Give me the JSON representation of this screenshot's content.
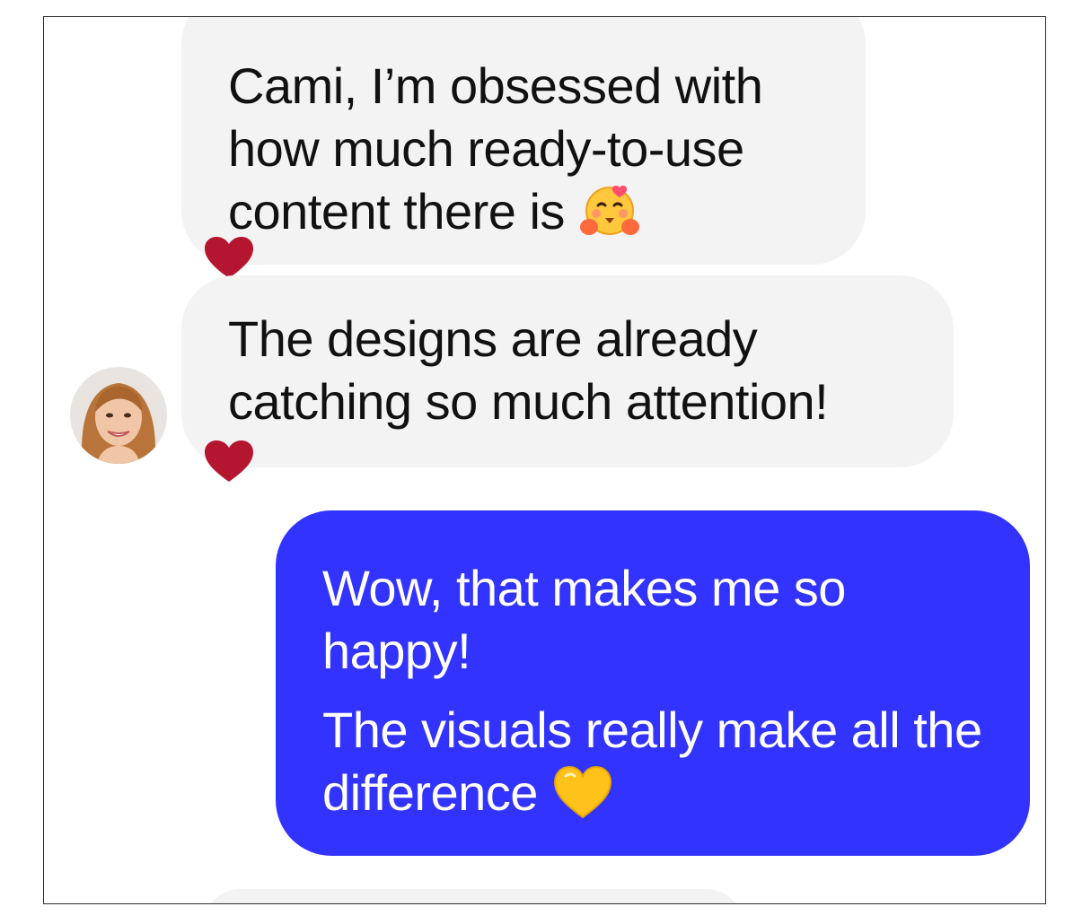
{
  "conversation": {
    "messages": [
      {
        "direction": "incoming",
        "text": "Cami, I’m obsessed with how much ready-to-use content there is",
        "emoji": "hugging-face-emoji",
        "reaction": "heart-reaction"
      },
      {
        "direction": "incoming",
        "text": "The designs are already catching so much attention!",
        "reaction": "heart-reaction",
        "sender_avatar": "woman-avatar"
      },
      {
        "direction": "outgoing",
        "paragraphs": [
          "Wow, that makes me so happy!",
          "The visuals really make all the difference"
        ],
        "emoji": "yellow-heart-emoji"
      }
    ]
  },
  "colors": {
    "incoming_bubble": "#f3f3f3",
    "outgoing_bubble": "#3333ff",
    "reaction_heart": "#b5162f",
    "outgoing_text": "#ffffff",
    "incoming_text": "#111111"
  }
}
